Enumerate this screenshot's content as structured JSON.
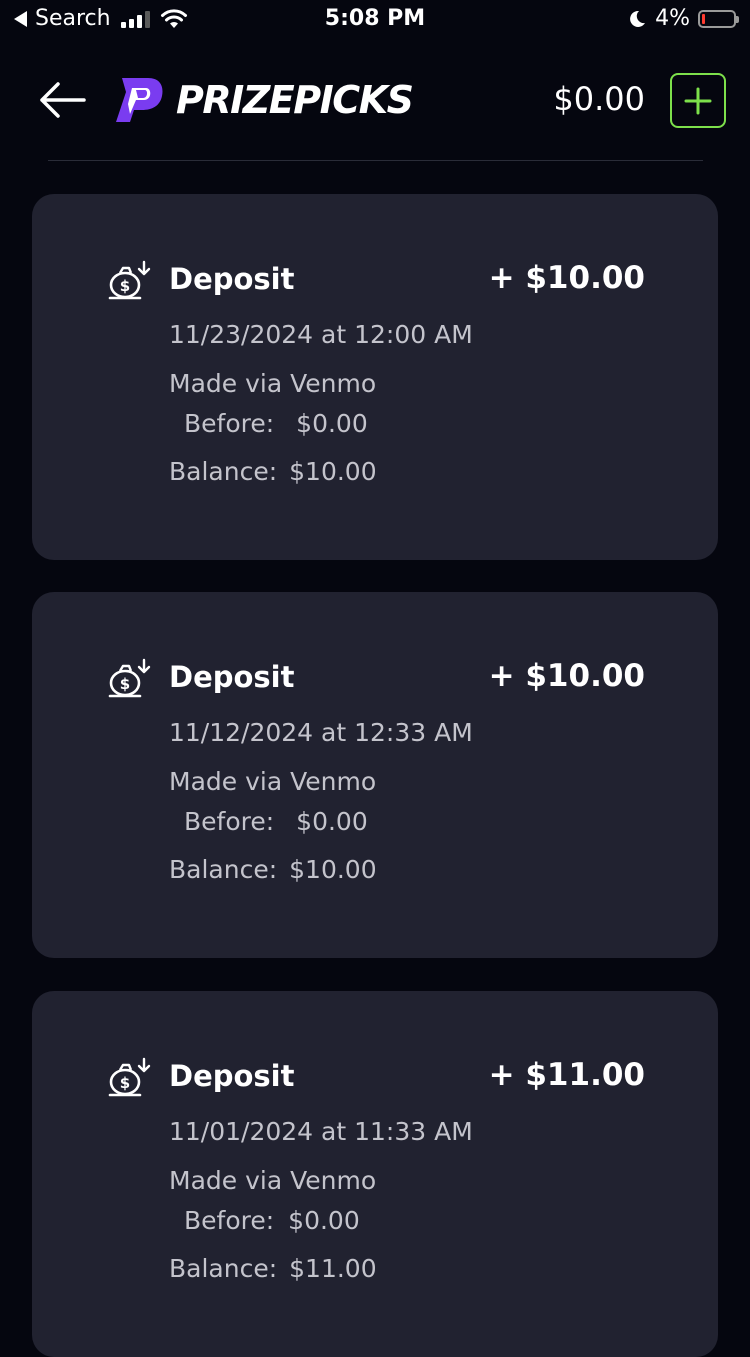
{
  "status_bar": {
    "back_label": "Search",
    "time": "5:08 PM",
    "battery": "4%"
  },
  "header": {
    "brand": "PRIZEPICKS",
    "balance": "$0.00",
    "brand_color": "#7a3cf0",
    "add_color": "#7de04b"
  },
  "transactions": [
    {
      "type": "Deposit",
      "amount": "+ $10.00",
      "date": "11/23/2024 at 12:00 AM",
      "method": "Made via Venmo",
      "before_label": "Before:",
      "before_value": "$0.00",
      "balance_label": "Balance:",
      "balance_value": "$10.00",
      "icon": "money-bag-deposit-icon"
    },
    {
      "type": "Deposit",
      "amount": "+ $10.00",
      "date": "11/12/2024 at 12:33 AM",
      "method": "Made via Venmo",
      "before_label": "Before:",
      "before_value": "$0.00",
      "balance_label": "Balance:",
      "balance_value": "$10.00",
      "icon": "money-bag-deposit-icon"
    },
    {
      "type": "Deposit",
      "amount": "+ $11.00",
      "date": "11/01/2024 at 11:33 AM",
      "method": "Made via Venmo",
      "before_label": "Before:",
      "before_value": "$0.00",
      "balance_label": "Balance:",
      "balance_value": "$11.00",
      "icon": "money-bag-deposit-icon"
    }
  ]
}
